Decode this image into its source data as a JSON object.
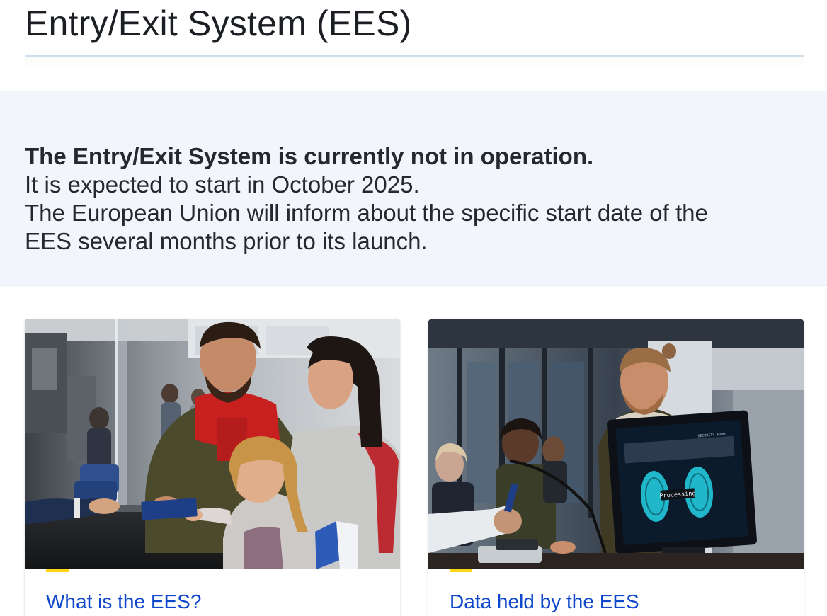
{
  "header": {
    "title": "Entry/Exit System (EES)"
  },
  "notice": {
    "lead": "The Entry/Exit System is currently not in operation.",
    "line1": "It is expected to start in October 2025.",
    "line2": "The European Union will inform about the specific start date of the",
    "line3": "EES several months prior to its launch."
  },
  "cards": [
    {
      "title": "What is the EES?",
      "image_alt": "Family handing passports at a border control desk"
    },
    {
      "title": "Data held by the EES",
      "image_alt": "Traveller at a fingerprint scanning terminal"
    }
  ],
  "screen": {
    "label": "Processing",
    "corner_label": "SECURITY FORM"
  },
  "colors": {
    "link": "#0e47cb",
    "accent": "#ffd617",
    "notice_bg": "#f2f5fc",
    "rule": "#cfdcec"
  }
}
